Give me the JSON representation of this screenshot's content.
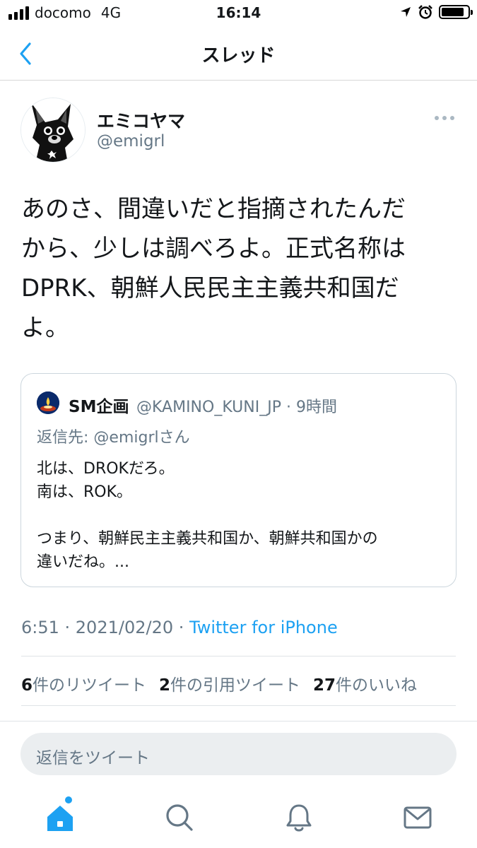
{
  "status_bar": {
    "carrier": "docomo",
    "network": "4G",
    "time": "16:14"
  },
  "nav": {
    "title": "スレッド",
    "back_icon": "chevron-left-icon"
  },
  "tweet": {
    "display_name": "エミコヤマ",
    "handle": "@emigrl",
    "lines": [
      "あのさ、間違いだと指摘されたんだ",
      "から、少しは調べろよ。正式名称は",
      "DPRK、朝鮮人民民主主義共和国だ",
      "よ。"
    ],
    "timestamp": "6:51 · 2021/02/20 · ",
    "source": "Twitter for iPhone"
  },
  "quote": {
    "name": "SM企画",
    "handle_time": "@KAMINO_KUNI_JP · 9時間",
    "reply_prefix": "返信先: ",
    "reply_mention": "@emigrl",
    "reply_suffix": "さん",
    "lines": [
      "北は、DROKだろ。",
      "南は、ROK。",
      "",
      "つまり、朝鮮民主主義共和国か、朝鮮共和国かの",
      "違いだね。..."
    ]
  },
  "stats": {
    "retweets_count": "6",
    "retweets_label": "件のリツイート",
    "quotes_count": "2",
    "quotes_label": "件の引用ツイート",
    "likes_count": "27",
    "likes_label": "件のいいね"
  },
  "reply": {
    "placeholder": "返信をツイート"
  },
  "tabs": {
    "home_icon": "home-icon",
    "search_icon": "search-icon",
    "notifications_icon": "bell-icon",
    "messages_icon": "mail-icon"
  },
  "colors": {
    "accent": "#1da1f2",
    "secondary_text": "#657786",
    "primary_text": "#14171a"
  }
}
